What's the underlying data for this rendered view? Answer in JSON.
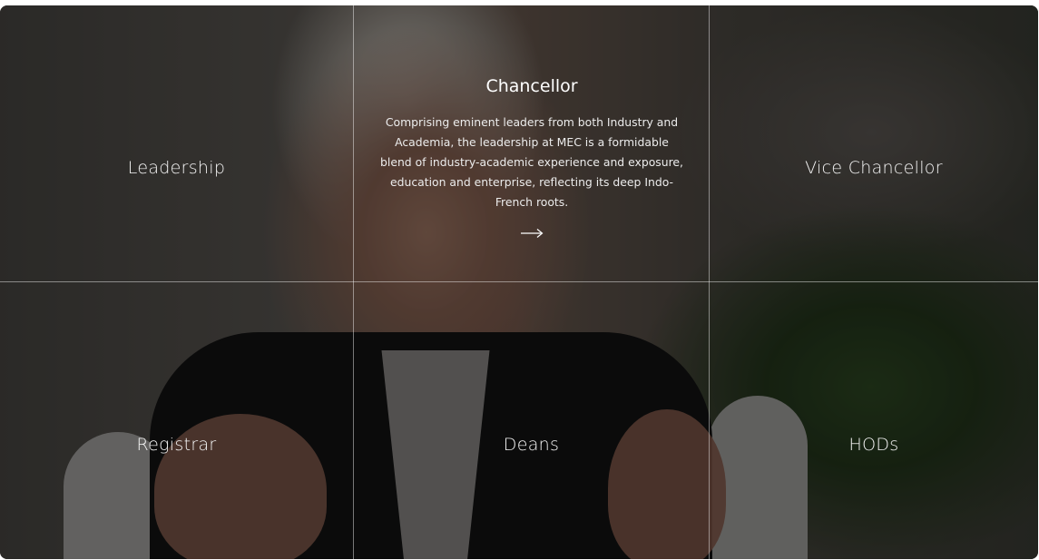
{
  "grid": {
    "cells": [
      {
        "label": "Leadership"
      },
      {
        "label": "Chancellor",
        "active": true,
        "description": "Comprising eminent leaders from both Industry and Academia, the leadership at MEC is a formidable blend of industry-academic experience and exposure, education and enterprise, reflecting its deep Indo-French roots."
      },
      {
        "label": "Vice Chancellor"
      },
      {
        "label": "Registrar"
      },
      {
        "label": "Deans"
      },
      {
        "label": "HODs"
      }
    ],
    "active_icon": "right-arrow-icon"
  },
  "colors": {
    "text": "#ffffff",
    "divider": "rgba(255,255,255,0.45)",
    "overlay": "rgba(0,0,0,0.42)"
  }
}
